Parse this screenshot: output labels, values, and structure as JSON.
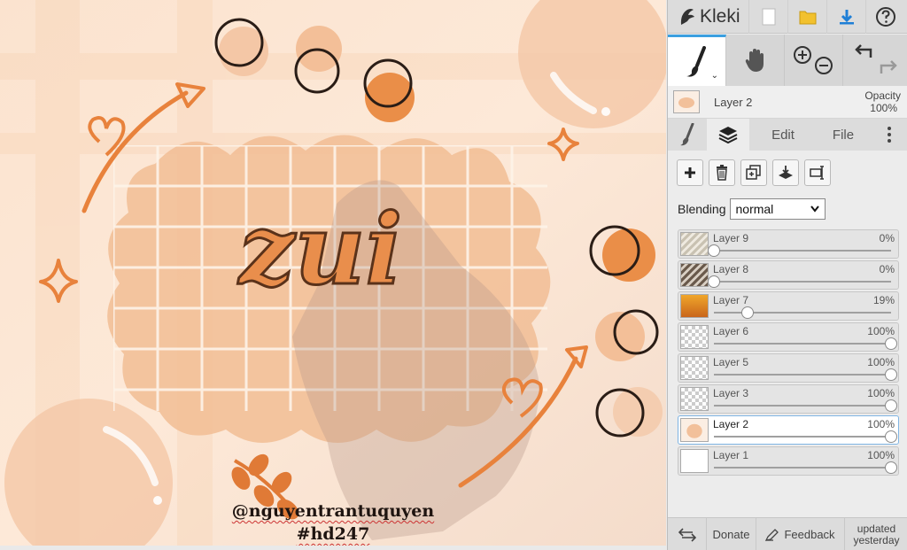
{
  "app": {
    "name": "Kleki",
    "colors": {
      "accent": "#3a9fe0",
      "artwork_peach": "#f3c49d",
      "artwork_orange": "#e8823c"
    }
  },
  "artwork": {
    "lettering": "zui",
    "credit_user": "@nguyentrantuquyen",
    "credit_tag": "#hd247"
  },
  "topbar": {
    "icons": [
      "kleki-logo-icon",
      "new-file-icon",
      "folder-icon",
      "download-icon",
      "help-icon"
    ]
  },
  "tools": {
    "active": "brush",
    "icons": [
      "brush-icon",
      "hand-icon",
      "zoom-in-icon",
      "zoom-out-icon",
      "undo-icon",
      "redo-icon"
    ]
  },
  "layer_info": {
    "name": "Layer 2",
    "opacity_label": "Opacity",
    "opacity_value": "100%"
  },
  "tabs": {
    "edit": "Edit",
    "file": "File",
    "active": "layers"
  },
  "blending": {
    "label": "Blending",
    "value": "normal"
  },
  "layers": [
    {
      "name": "Layer 9",
      "opacity": "0%",
      "fraction": 0.0,
      "thumb": "stripes"
    },
    {
      "name": "Layer 8",
      "opacity": "0%",
      "fraction": 0.0,
      "thumb": "dark-stripes"
    },
    {
      "name": "Layer 7",
      "opacity": "19%",
      "fraction": 0.19,
      "thumb": "photo"
    },
    {
      "name": "Layer 6",
      "opacity": "100%",
      "fraction": 1.0,
      "thumb": "checker"
    },
    {
      "name": "Layer 5",
      "opacity": "100%",
      "fraction": 1.0,
      "thumb": "checker"
    },
    {
      "name": "Layer 3",
      "opacity": "100%",
      "fraction": 1.0,
      "thumb": "checker"
    },
    {
      "name": "Layer 2",
      "opacity": "100%",
      "fraction": 1.0,
      "thumb": "peach",
      "active": true
    },
    {
      "name": "Layer 1",
      "opacity": "100%",
      "fraction": 1.0,
      "thumb": "white"
    }
  ],
  "bottombar": {
    "donate": "Donate",
    "feedback": "Feedback",
    "updated_line1": "updated",
    "updated_line2": "yesterday"
  }
}
